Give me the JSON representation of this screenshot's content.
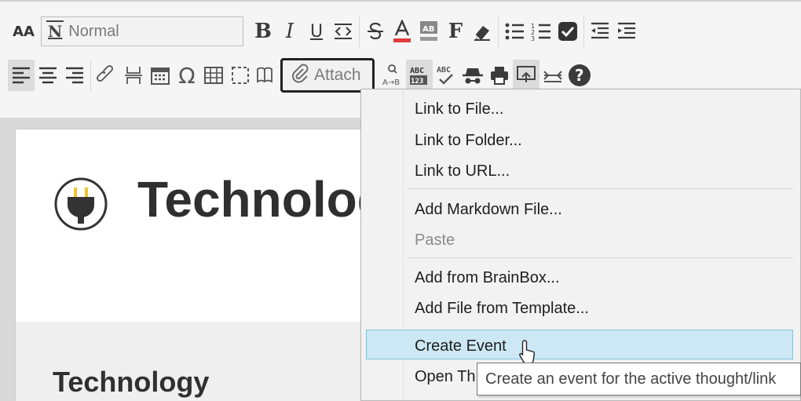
{
  "toolbar": {
    "font_size_label": "AA",
    "style_select_value": "Normal",
    "bold_label": "B",
    "italic_label": "I",
    "underline_label": "U",
    "font_label": "F",
    "special_char_label": "Ω",
    "attach_label": "Attach"
  },
  "page": {
    "hero_title": "Technolog",
    "section_title": "Technology"
  },
  "menu": {
    "items": [
      {
        "label": "Link to File...",
        "enabled": true
      },
      {
        "label": "Link to Folder...",
        "enabled": true
      },
      {
        "label": "Link to URL...",
        "enabled": true
      },
      {
        "label": "Add Markdown File...",
        "enabled": true
      },
      {
        "label": "Paste",
        "enabled": false
      },
      {
        "label": "Add from BrainBox...",
        "enabled": true
      },
      {
        "label": "Add File from Template...",
        "enabled": true
      },
      {
        "label": "Create Event",
        "enabled": true,
        "highlighted": true
      },
      {
        "label": "Open Th",
        "enabled": true
      }
    ]
  },
  "tooltip": {
    "text": "Create an event for the active thought/link"
  },
  "colors": {
    "highlight_bg": "#cce8f4",
    "highlight_border": "#7ec3e3",
    "toolbar_bg": "#f5f5f5",
    "plug_yellow": "#f2c230"
  }
}
